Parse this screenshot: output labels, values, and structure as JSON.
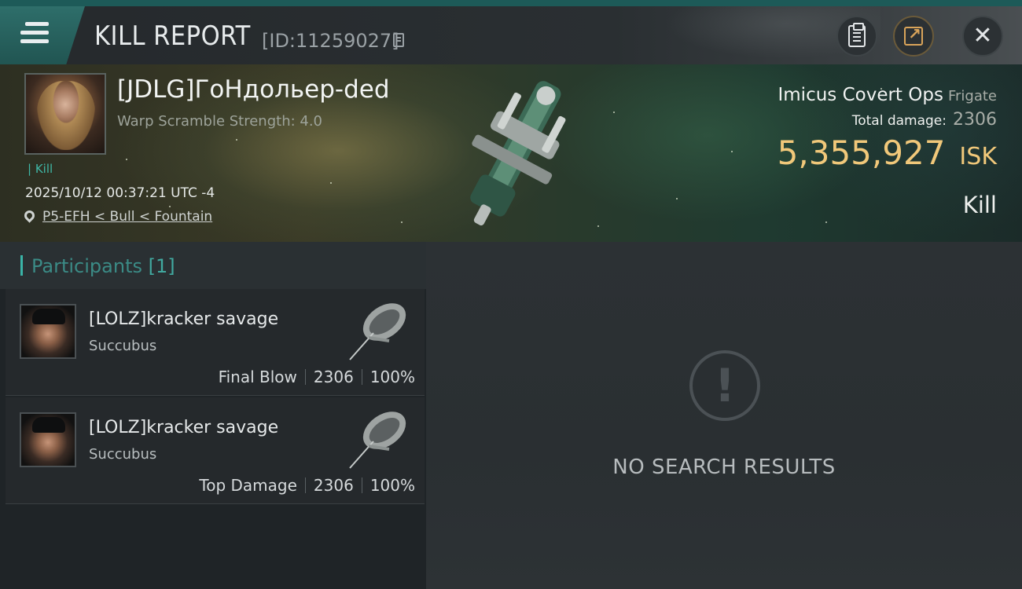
{
  "header": {
    "title": "KILL REPORT",
    "report_id": "[ID:11259027]",
    "accent_color": "#1d5a58"
  },
  "victim": {
    "name": "[JDLG]ГоНдольер-ded",
    "warp_scramble": "Warp Scramble Strength: 4.0",
    "kill_tag": "| Kill",
    "timestamp": "2025/10/12 00:37:21 UTC -4",
    "location": "P5-EFH < Bull < Fountain",
    "ship_name": "Imicus Covert Ops",
    "ship_class": "Frigate",
    "total_damage_label": "Total damage:",
    "total_damage_value": "2306",
    "isk_amount": "5,355,927",
    "isk_unit": "ISK",
    "result_label": "Kill",
    "isk_color": "#f1c87a"
  },
  "participants": {
    "label": "Participants",
    "count": "[1]",
    "rows": [
      {
        "name": "[LOLZ]kracker savage",
        "ship": "Succubus",
        "role": "Final Blow",
        "damage": "2306",
        "percent": "100%"
      },
      {
        "name": "[LOLZ]kracker savage",
        "ship": "Succubus",
        "role": "Top Damage",
        "damage": "2306",
        "percent": "100%"
      }
    ]
  },
  "details_panel": {
    "empty_message": "NO SEARCH RESULTS"
  },
  "icons": {
    "menu": "hamburger-menu-icon",
    "copy": "copy-icon",
    "clipboard": "clipboard-icon",
    "share": "share-icon",
    "close": "close-icon",
    "location": "location-pin-icon",
    "empty": "exclamation-icon"
  }
}
